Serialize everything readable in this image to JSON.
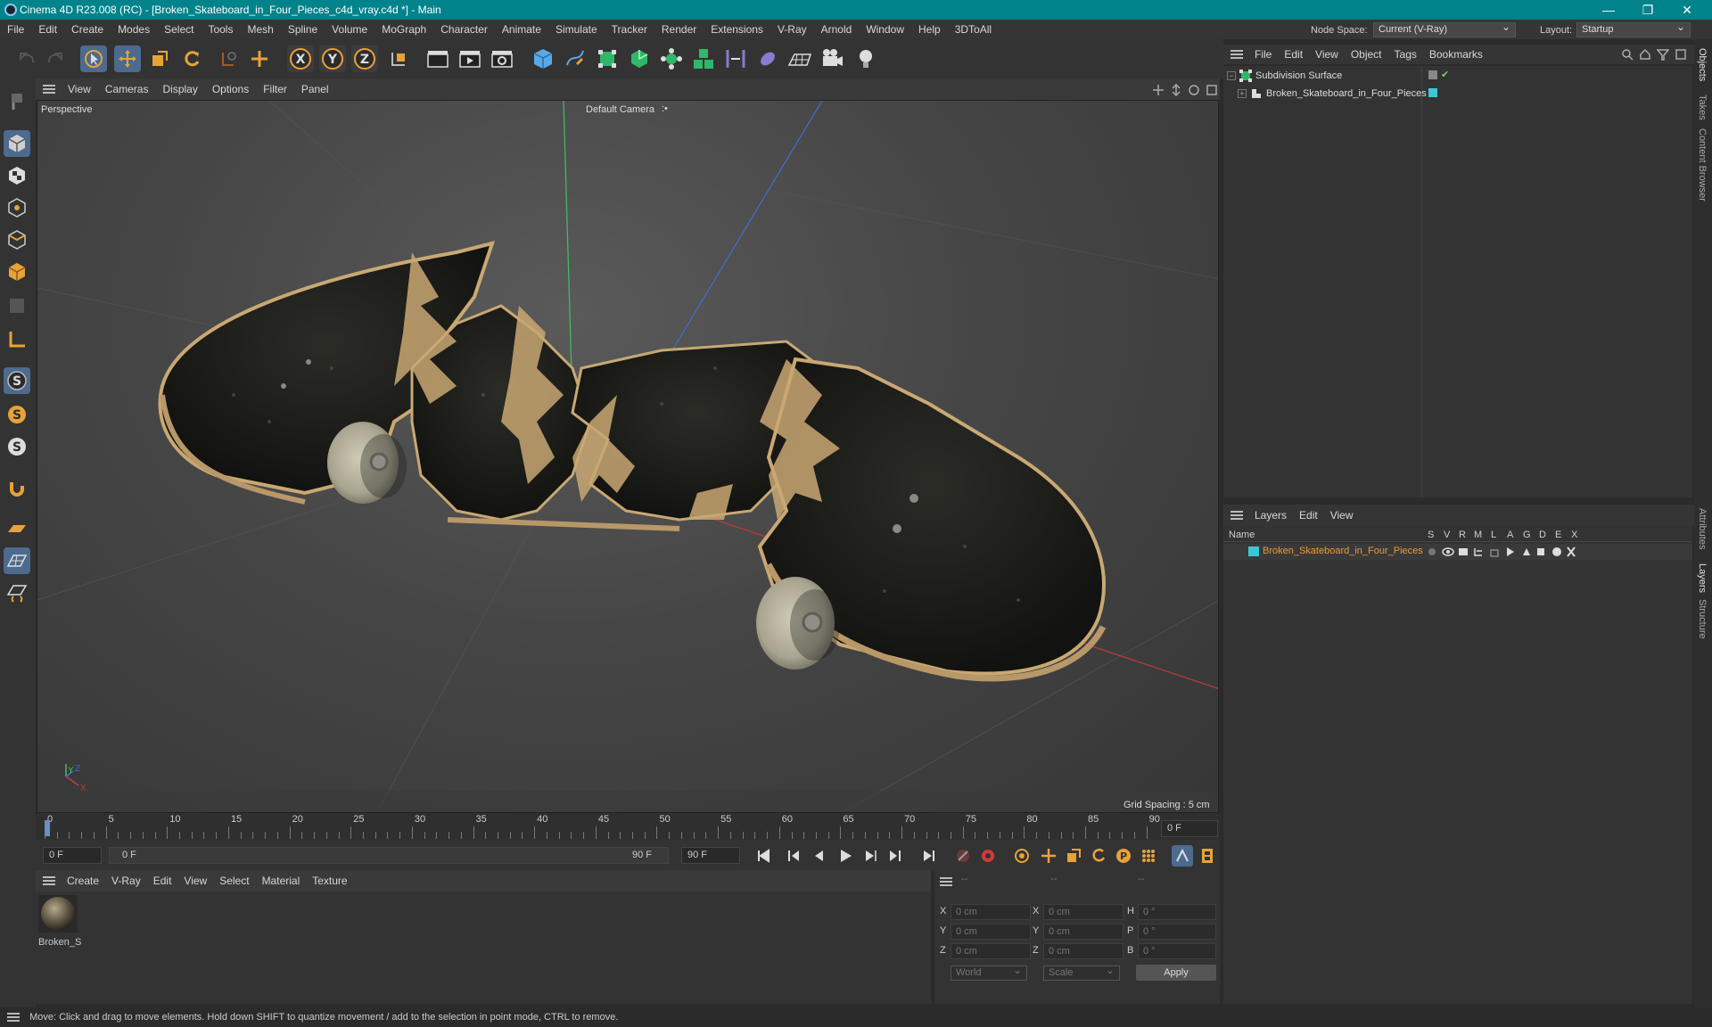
{
  "window": {
    "title": "Cinema 4D R23.008 (RC) - [Broken_Skateboard_in_Four_Pieces_c4d_vray.c4d *] - Main",
    "controls": [
      "—",
      "❐",
      "✕"
    ]
  },
  "menubar": {
    "items": [
      "File",
      "Edit",
      "Create",
      "Modes",
      "Select",
      "Tools",
      "Mesh",
      "Spline",
      "Volume",
      "MoGraph",
      "Character",
      "Animate",
      "Simulate",
      "Tracker",
      "Render",
      "Extensions",
      "V-Ray",
      "Arnold",
      "Window",
      "Help",
      "3DToAll"
    ],
    "node_space_label": "Node Space:",
    "node_space_value": "Current (V-Ray)",
    "layout_label": "Layout:",
    "layout_value": "Startup"
  },
  "viewport": {
    "menu": [
      "View",
      "Cameras",
      "Display",
      "Options",
      "Filter",
      "Panel"
    ],
    "view_name": "Perspective",
    "camera_label": "Default Camera",
    "camera_marker": ":•",
    "grid_spacing": "Grid Spacing : 5 cm",
    "axis_y": "Y",
    "axis_z": "Z",
    "axis_x": "X"
  },
  "timeline": {
    "ticks": [
      "0",
      "5",
      "10",
      "15",
      "20",
      "25",
      "30",
      "35",
      "40",
      "45",
      "50",
      "55",
      "60",
      "65",
      "70",
      "75",
      "80",
      "85",
      "90"
    ],
    "current_frame_right": "0 F",
    "start_frame": "0 F",
    "range_start": "0 F",
    "range_end": "90 F",
    "end_frame": "90 F"
  },
  "material_manager": {
    "menu": [
      "Create",
      "V-Ray",
      "Edit",
      "View",
      "Select",
      "Material",
      "Texture"
    ],
    "material_name": "Broken_S"
  },
  "coordinates": {
    "header": [
      "--",
      "--",
      "--"
    ],
    "rows": [
      {
        "a": "X",
        "av": "0 cm",
        "b": "X",
        "bv": "0 cm",
        "c": "H",
        "cv": "0 °"
      },
      {
        "a": "Y",
        "av": "0 cm",
        "b": "Y",
        "bv": "0 cm",
        "c": "P",
        "cv": "0 °"
      },
      {
        "a": "Z",
        "av": "0 cm",
        "b": "Z",
        "bv": "0 cm",
        "c": "B",
        "cv": "0 °"
      }
    ],
    "space": "World",
    "mode": "Scale",
    "apply": "Apply"
  },
  "object_manager": {
    "menu": [
      "File",
      "Edit",
      "View",
      "Object",
      "Tags",
      "Bookmarks"
    ],
    "objects": [
      {
        "name": "Subdivision Surface"
      },
      {
        "name": "Broken_Skateboard_in_Four_Pieces"
      }
    ]
  },
  "layer_manager": {
    "menu": [
      "Layers",
      "Edit",
      "View"
    ],
    "columns": [
      "Name",
      "S",
      "V",
      "R",
      "M",
      "L",
      "A",
      "G",
      "D",
      "E",
      "X"
    ],
    "layers": [
      {
        "name": "Broken_Skateboard_in_Four_Pieces",
        "color": "#3fc6d4"
      }
    ]
  },
  "side_tabs": [
    "Objects",
    "Takes",
    "Content Browser",
    "Attributes",
    "Layers",
    "Structure"
  ],
  "status": "Move: Click and drag to move elements. Hold down SHIFT to quantize movement / add to the selection in point mode, CTRL to remove.",
  "colors": {
    "accent": "#00838a",
    "highlight": "#4d6a8f",
    "layer_text": "#e89a3c"
  }
}
